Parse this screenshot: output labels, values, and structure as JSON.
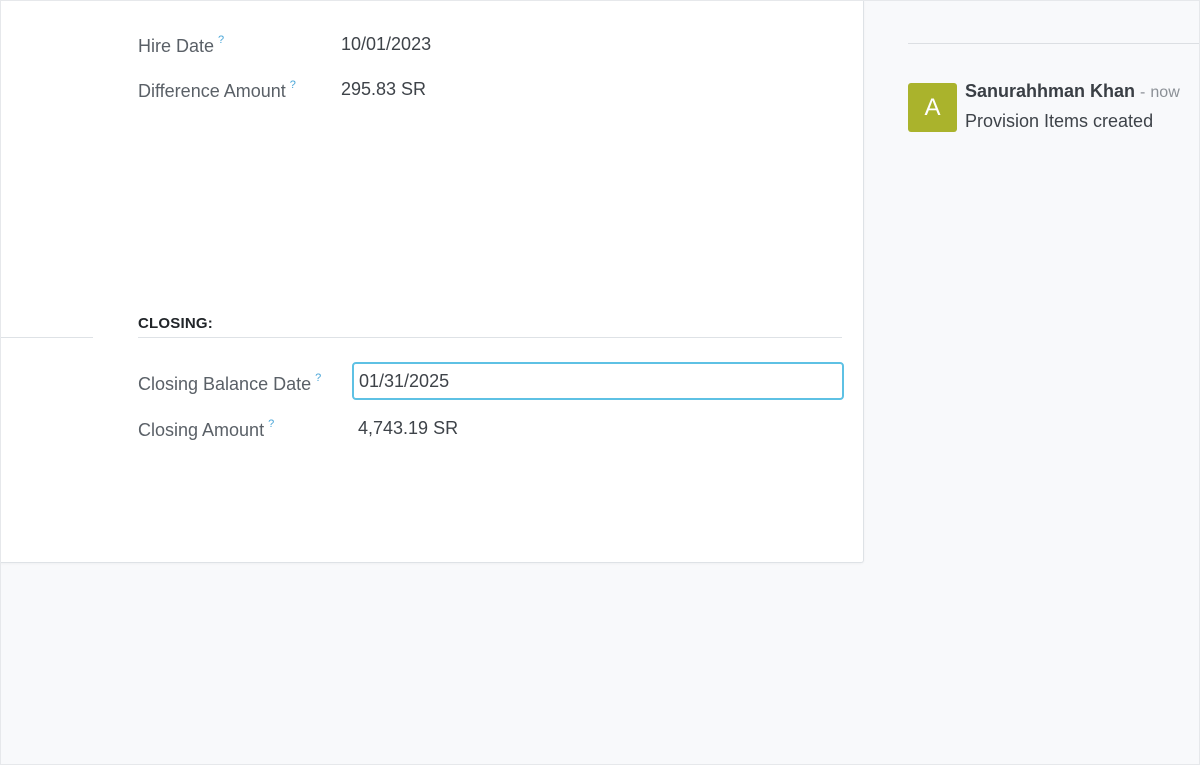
{
  "form": {
    "hire_date": {
      "label": "Hire Date",
      "help": "?",
      "value": "10/01/2023"
    },
    "difference_amount": {
      "label": "Difference Amount",
      "help": "?",
      "value": "295.83 SR"
    },
    "closing_section": {
      "title": "CLOSING:",
      "closing_balance_date": {
        "label": "Closing Balance Date",
        "help": "?",
        "value": "01/31/2025"
      },
      "closing_amount": {
        "label": "Closing Amount",
        "help": "?",
        "value": "4,743.19 SR"
      }
    }
  },
  "chatter": {
    "message": {
      "avatar_letter": "A",
      "avatar_color": "#aab32c",
      "author": "Sanurahhman Khan",
      "separator": "-",
      "time": "now",
      "body": "Provision Items created"
    }
  },
  "colors": {
    "focus_border": "#5ec1e4",
    "help_mark": "#4aa6d8"
  }
}
